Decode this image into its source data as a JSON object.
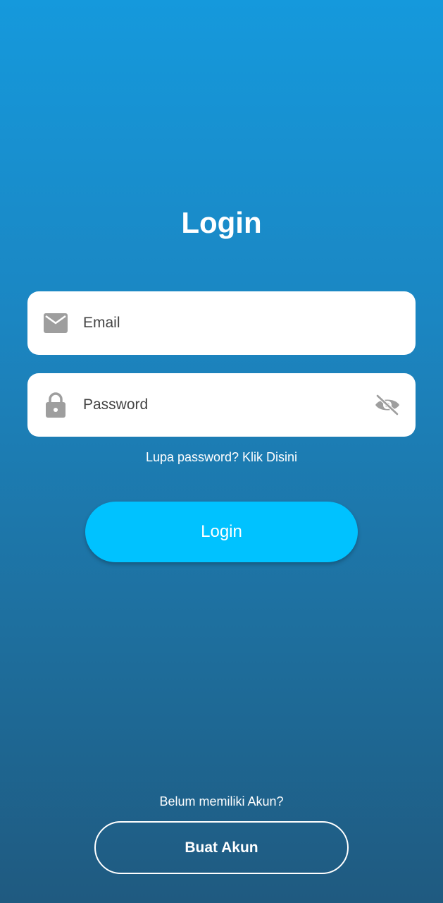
{
  "page": {
    "title": "Login"
  },
  "form": {
    "email": {
      "placeholder": "Email",
      "value": "",
      "icon": "mail-icon"
    },
    "password": {
      "placeholder": "Password",
      "value": "",
      "icon": "lock-icon",
      "toggle_icon": "eye-off-icon"
    },
    "forgot_label": "Lupa password? Klik Disini",
    "login_label": "Login"
  },
  "footer": {
    "prompt": "Belum memiliki Akun?",
    "create_label": "Buat Akun"
  },
  "colors": {
    "background_top": "#1599dc",
    "background_bottom": "#1f5a80",
    "login_button": "#00c2ff",
    "field_icon": "#9e9e9e",
    "field_text": "#444444"
  }
}
